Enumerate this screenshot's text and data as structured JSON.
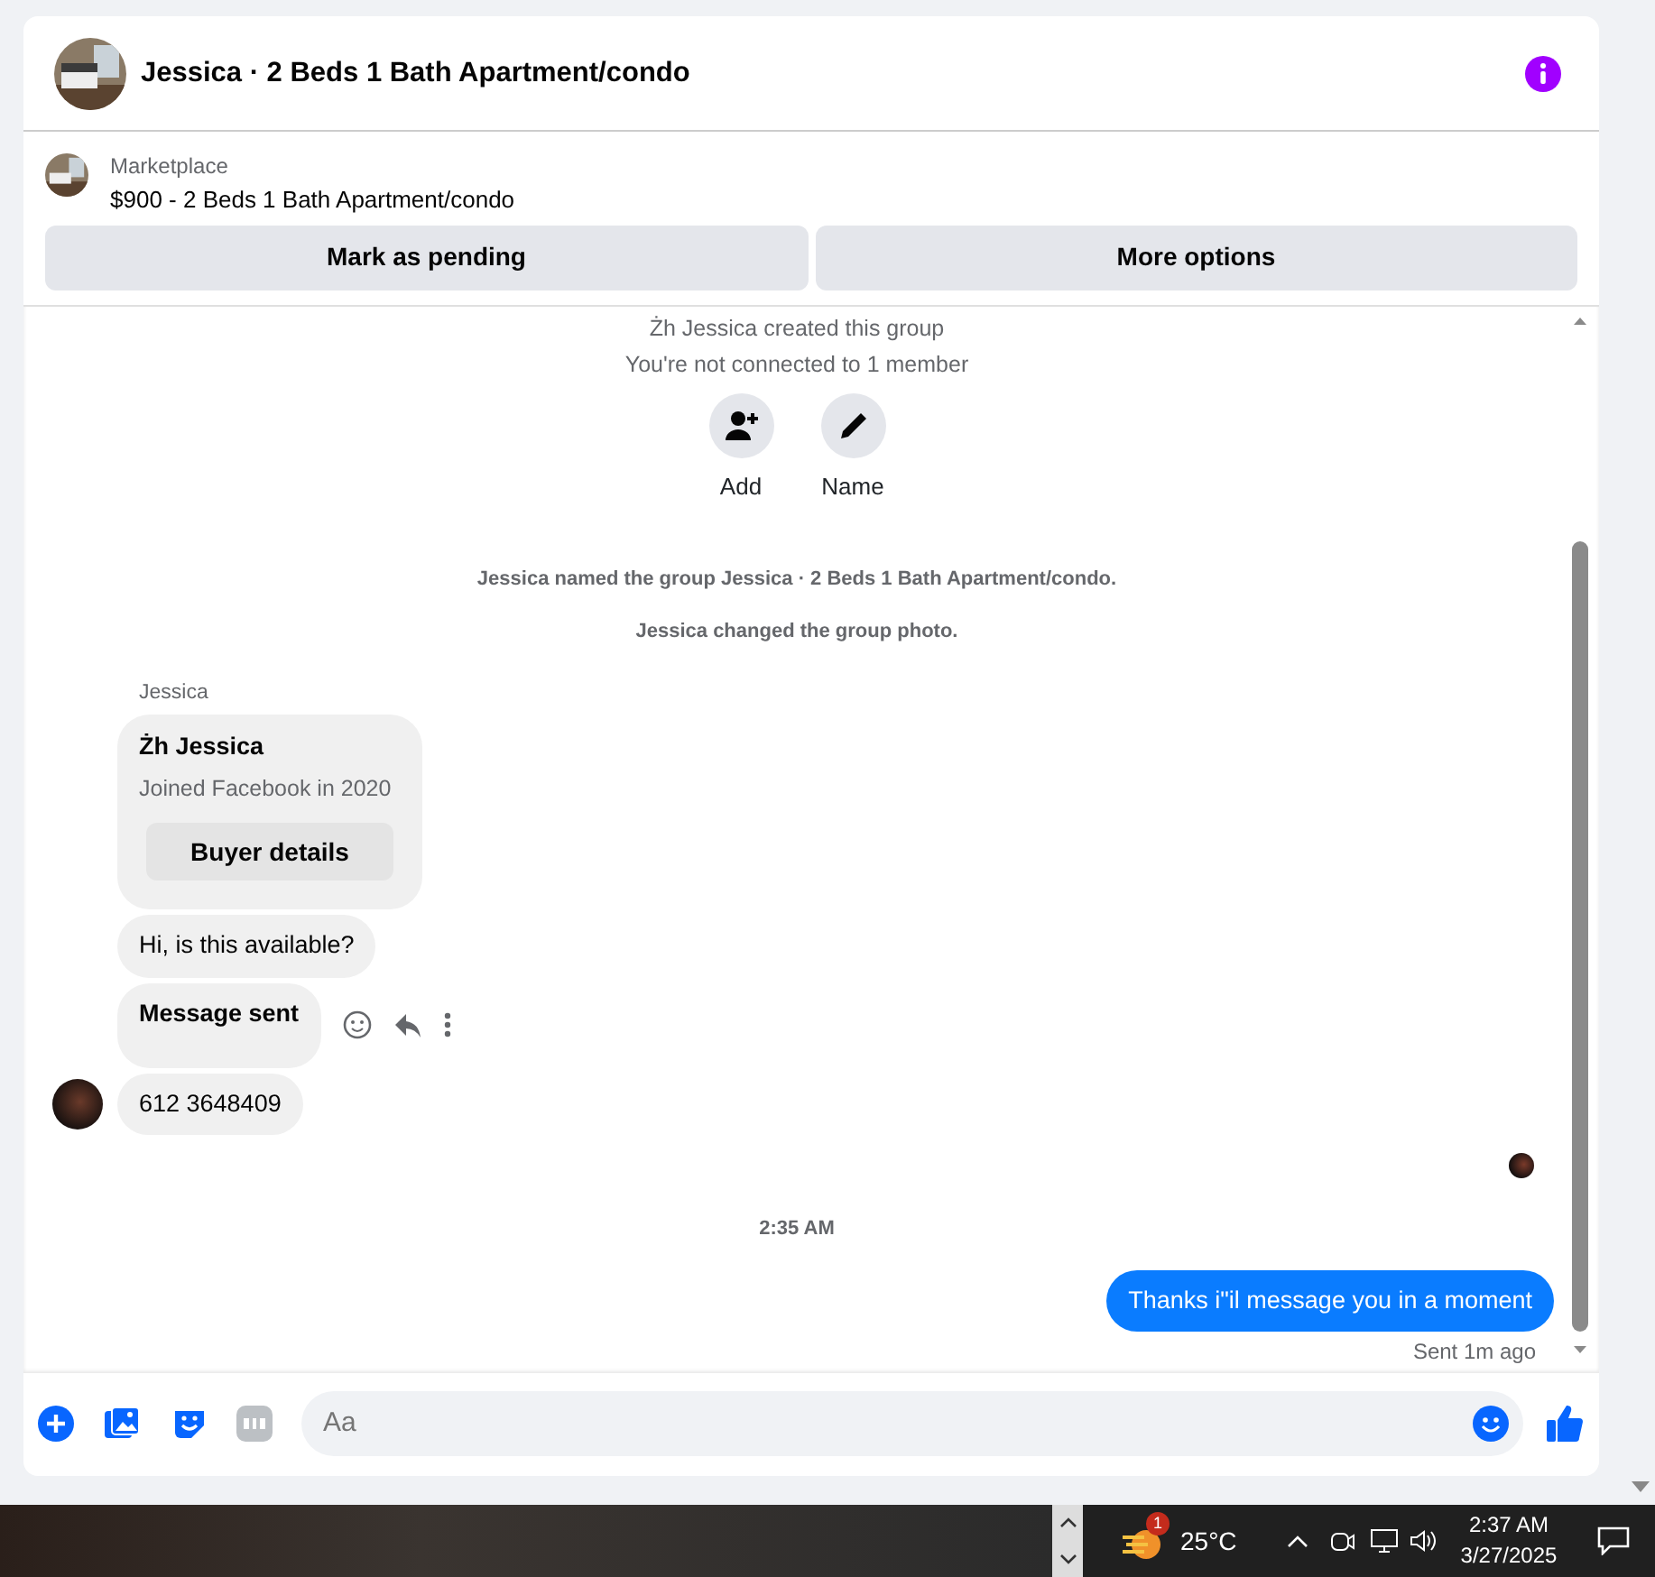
{
  "header": {
    "title": "Jessica · 2 Beds 1 Bath Apartment/condo"
  },
  "listing": {
    "label": "Marketplace",
    "text": "$900 - 2 Beds 1 Bath Apartment/condo"
  },
  "actions": [
    "Mark as pending",
    "More options"
  ],
  "chat": {
    "notices": [
      "Żh Jessica created this group",
      "You're not connected to 1 member"
    ],
    "group_actions": [
      {
        "kind": "add",
        "label": "Add"
      },
      {
        "kind": "name",
        "label": "Name"
      }
    ],
    "events": [
      "Jessica named the group Jessica · 2 Beds 1 Bath Apartment/condo.",
      "Jessica changed the group photo."
    ],
    "sender": "Jessica",
    "buyer_card": {
      "name": "Żh Jessica",
      "subtitle": "Joined Facebook in 2020",
      "button": "Buyer details"
    },
    "messages": [
      {
        "text": "Hi, is this available?",
        "bold": false,
        "hover": false
      },
      {
        "text": "Message sent",
        "bold": true,
        "hover": true
      },
      {
        "text": "612 3648409",
        "bold": false,
        "hover": false
      }
    ],
    "timestamp": "2:35 AM",
    "outgoing": {
      "text": "Thanks i\"il message you in a moment",
      "receipt": "Sent 1m ago"
    }
  },
  "composer": {
    "placeholder": "Aa"
  },
  "taskbar": {
    "weather_badge": "1",
    "temperature": "25°C",
    "time": "2:37 AM",
    "date": "3/27/2025"
  }
}
